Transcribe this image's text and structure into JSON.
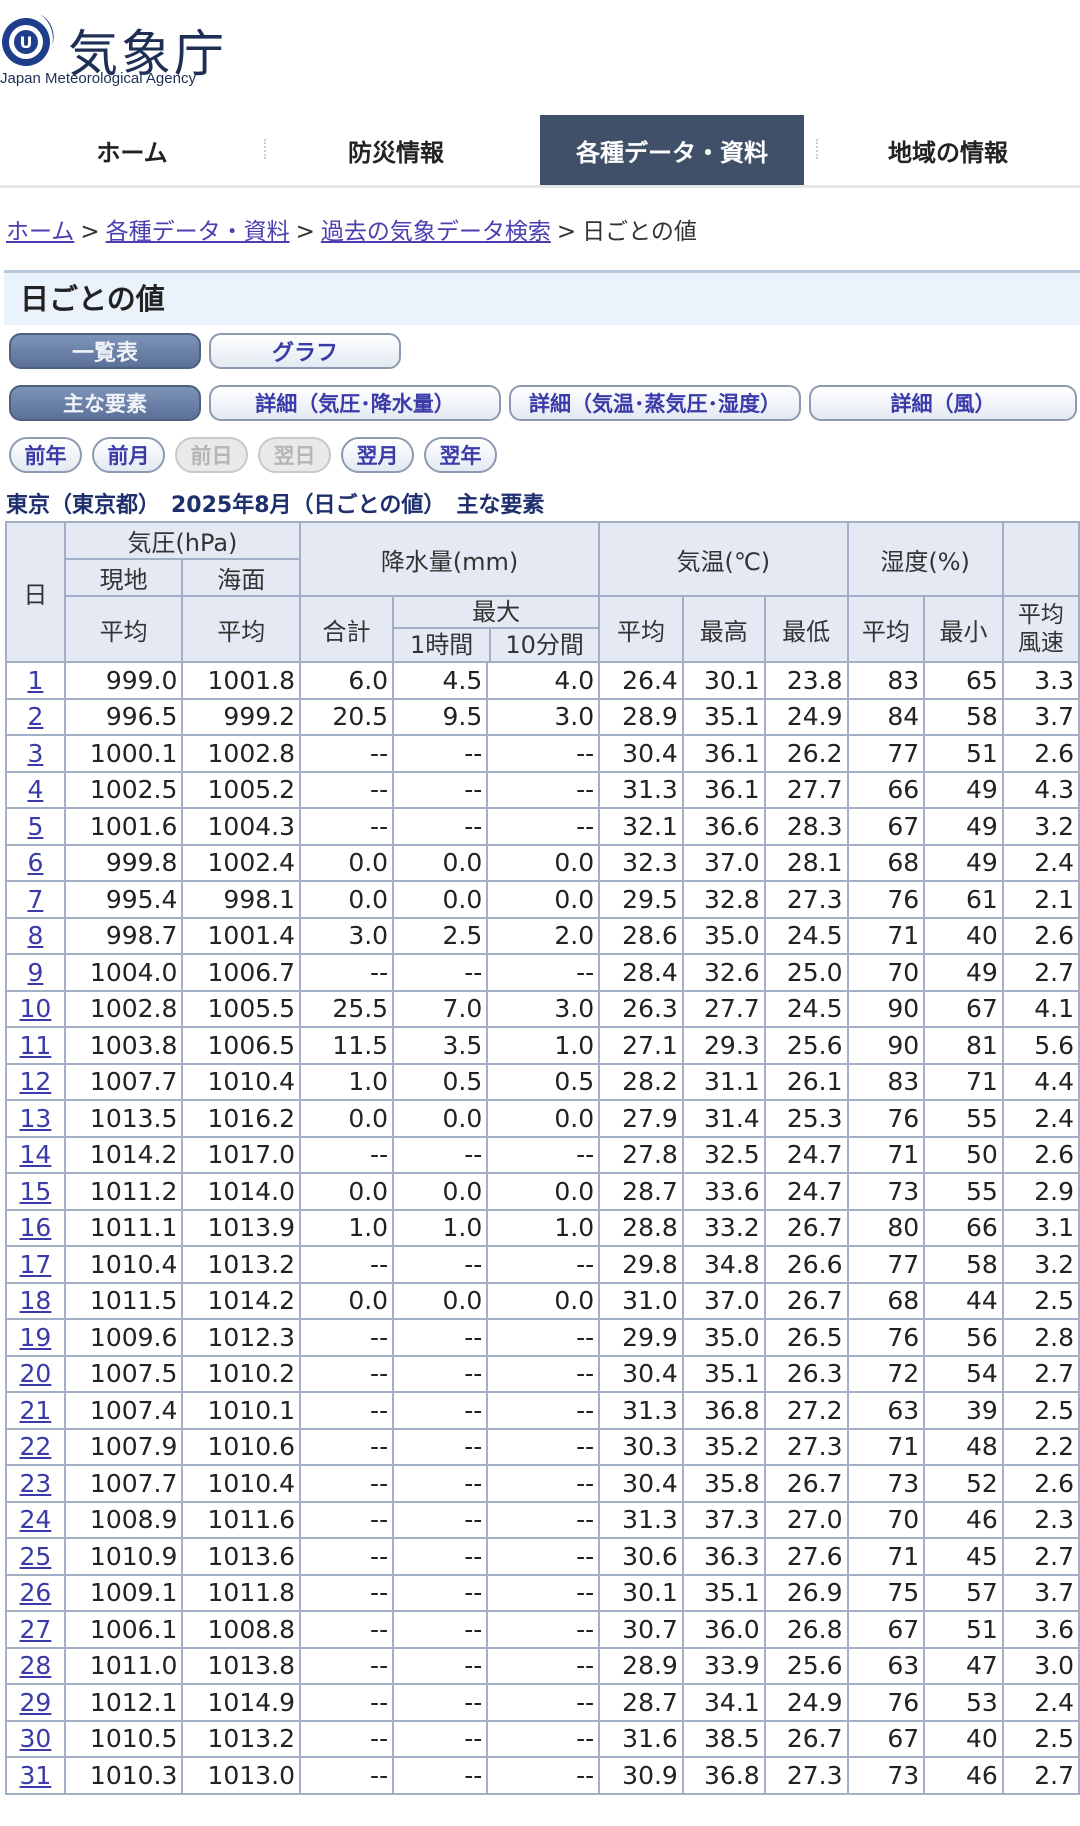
{
  "logo": {
    "name": "気象庁",
    "subtitle": "Japan Meteorological Agency",
    "mark_letter": "U"
  },
  "gnav": [
    "ホーム",
    "防災情報",
    "各種データ・資料",
    "地域の情報"
  ],
  "breadcrumb": {
    "items": [
      "ホーム",
      "各種データ・資料",
      "過去の気象データ検索"
    ],
    "current": "日ごとの値",
    "sep": ">"
  },
  "page_title": "日ごとの値",
  "view_tabs": [
    "一覧表",
    "グラフ"
  ],
  "element_tabs": [
    "主な要素",
    "詳細（気圧･降水量）",
    "詳細（気温･蒸気圧･湿度）",
    "詳細（風）"
  ],
  "period_nav": [
    "前年",
    "前月",
    "前日",
    "翌日",
    "翌月",
    "翌年"
  ],
  "section_title": "東京（東京都）　2025年8月（日ごとの値）　主な要素",
  "table": {
    "h_day": "日",
    "h_pressure": "気圧(hPa)",
    "h_local": "現地",
    "h_sea": "海面",
    "h_avg": "平均",
    "h_precip": "降水量(mm)",
    "h_total": "合計",
    "h_max": "最大",
    "h_1h": "1時間",
    "h_10m": "10分間",
    "h_temp": "気温(℃)",
    "h_tmax": "最高",
    "h_tmin": "最低",
    "h_hum": "湿度(%)",
    "h_hmin": "最小",
    "h_wind": "平均風速",
    "rows": [
      [
        "1",
        "999.0",
        "1001.8",
        "6.0",
        "4.5",
        "4.0",
        "26.4",
        "30.1",
        "23.8",
        "83",
        "65",
        "3.3"
      ],
      [
        "2",
        "996.5",
        "999.2",
        "20.5",
        "9.5",
        "3.0",
        "28.9",
        "35.1",
        "24.9",
        "84",
        "58",
        "3.7"
      ],
      [
        "3",
        "1000.1",
        "1002.8",
        "--",
        "--",
        "--",
        "30.4",
        "36.1",
        "26.2",
        "77",
        "51",
        "2.6"
      ],
      [
        "4",
        "1002.5",
        "1005.2",
        "--",
        "--",
        "--",
        "31.3",
        "36.1",
        "27.7",
        "66",
        "49",
        "4.3"
      ],
      [
        "5",
        "1001.6",
        "1004.3",
        "--",
        "--",
        "--",
        "32.1",
        "36.6",
        "28.3",
        "67",
        "49",
        "3.2"
      ],
      [
        "6",
        "999.8",
        "1002.4",
        "0.0",
        "0.0",
        "0.0",
        "32.3",
        "37.0",
        "28.1",
        "68",
        "49",
        "2.4"
      ],
      [
        "7",
        "995.4",
        "998.1",
        "0.0",
        "0.0",
        "0.0",
        "29.5",
        "32.8",
        "27.3",
        "76",
        "61",
        "2.1"
      ],
      [
        "8",
        "998.7",
        "1001.4",
        "3.0",
        "2.5",
        "2.0",
        "28.6",
        "35.0",
        "24.5",
        "71",
        "40",
        "2.6"
      ],
      [
        "9",
        "1004.0",
        "1006.7",
        "--",
        "--",
        "--",
        "28.4",
        "32.6",
        "25.0",
        "70",
        "49",
        "2.7"
      ],
      [
        "10",
        "1002.8",
        "1005.5",
        "25.5",
        "7.0",
        "3.0",
        "26.3",
        "27.7",
        "24.5",
        "90",
        "67",
        "4.1"
      ],
      [
        "11",
        "1003.8",
        "1006.5",
        "11.5",
        "3.5",
        "1.0",
        "27.1",
        "29.3",
        "25.6",
        "90",
        "81",
        "5.6"
      ],
      [
        "12",
        "1007.7",
        "1010.4",
        "1.0",
        "0.5",
        "0.5",
        "28.2",
        "31.1",
        "26.1",
        "83",
        "71",
        "4.4"
      ],
      [
        "13",
        "1013.5",
        "1016.2",
        "0.0",
        "0.0",
        "0.0",
        "27.9",
        "31.4",
        "25.3",
        "76",
        "55",
        "2.4"
      ],
      [
        "14",
        "1014.2",
        "1017.0",
        "--",
        "--",
        "--",
        "27.8",
        "32.5",
        "24.7",
        "71",
        "50",
        "2.6"
      ],
      [
        "15",
        "1011.2",
        "1014.0",
        "0.0",
        "0.0",
        "0.0",
        "28.7",
        "33.6",
        "24.7",
        "73",
        "55",
        "2.9"
      ],
      [
        "16",
        "1011.1",
        "1013.9",
        "1.0",
        "1.0",
        "1.0",
        "28.8",
        "33.2",
        "26.7",
        "80",
        "66",
        "3.1"
      ],
      [
        "17",
        "1010.4",
        "1013.2",
        "--",
        "--",
        "--",
        "29.8",
        "34.8",
        "26.6",
        "77",
        "58",
        "3.2"
      ],
      [
        "18",
        "1011.5",
        "1014.2",
        "0.0",
        "0.0",
        "0.0",
        "31.0",
        "37.0",
        "26.7",
        "68",
        "44",
        "2.5"
      ],
      [
        "19",
        "1009.6",
        "1012.3",
        "--",
        "--",
        "--",
        "29.9",
        "35.0",
        "26.5",
        "76",
        "56",
        "2.8"
      ],
      [
        "20",
        "1007.5",
        "1010.2",
        "--",
        "--",
        "--",
        "30.4",
        "35.1",
        "26.3",
        "72",
        "54",
        "2.7"
      ],
      [
        "21",
        "1007.4",
        "1010.1",
        "--",
        "--",
        "--",
        "31.3",
        "36.8",
        "27.2",
        "63",
        "39",
        "2.5"
      ],
      [
        "22",
        "1007.9",
        "1010.6",
        "--",
        "--",
        "--",
        "30.3",
        "35.2",
        "27.3",
        "71",
        "48",
        "2.2"
      ],
      [
        "23",
        "1007.7",
        "1010.4",
        "--",
        "--",
        "--",
        "30.4",
        "35.8",
        "26.7",
        "73",
        "52",
        "2.6"
      ],
      [
        "24",
        "1008.9",
        "1011.6",
        "--",
        "--",
        "--",
        "31.3",
        "37.3",
        "27.0",
        "70",
        "46",
        "2.3"
      ],
      [
        "25",
        "1010.9",
        "1013.6",
        "--",
        "--",
        "--",
        "30.6",
        "36.3",
        "27.6",
        "71",
        "45",
        "2.7"
      ],
      [
        "26",
        "1009.1",
        "1011.8",
        "--",
        "--",
        "--",
        "30.1",
        "35.1",
        "26.9",
        "75",
        "57",
        "3.7"
      ],
      [
        "27",
        "1006.1",
        "1008.8",
        "--",
        "--",
        "--",
        "30.7",
        "36.0",
        "26.8",
        "67",
        "51",
        "3.6"
      ],
      [
        "28",
        "1011.0",
        "1013.8",
        "--",
        "--",
        "--",
        "28.9",
        "33.9",
        "25.6",
        "63",
        "47",
        "3.0"
      ],
      [
        "29",
        "1012.1",
        "1014.9",
        "--",
        "--",
        "--",
        "28.7",
        "34.1",
        "24.9",
        "76",
        "53",
        "2.4"
      ],
      [
        "30",
        "1010.5",
        "1013.2",
        "--",
        "--",
        "--",
        "31.6",
        "38.5",
        "26.7",
        "67",
        "40",
        "2.5"
      ],
      [
        "31",
        "1010.3",
        "1013.0",
        "--",
        "--",
        "--",
        "30.9",
        "36.8",
        "27.3",
        "73",
        "46",
        "2.7"
      ]
    ]
  }
}
